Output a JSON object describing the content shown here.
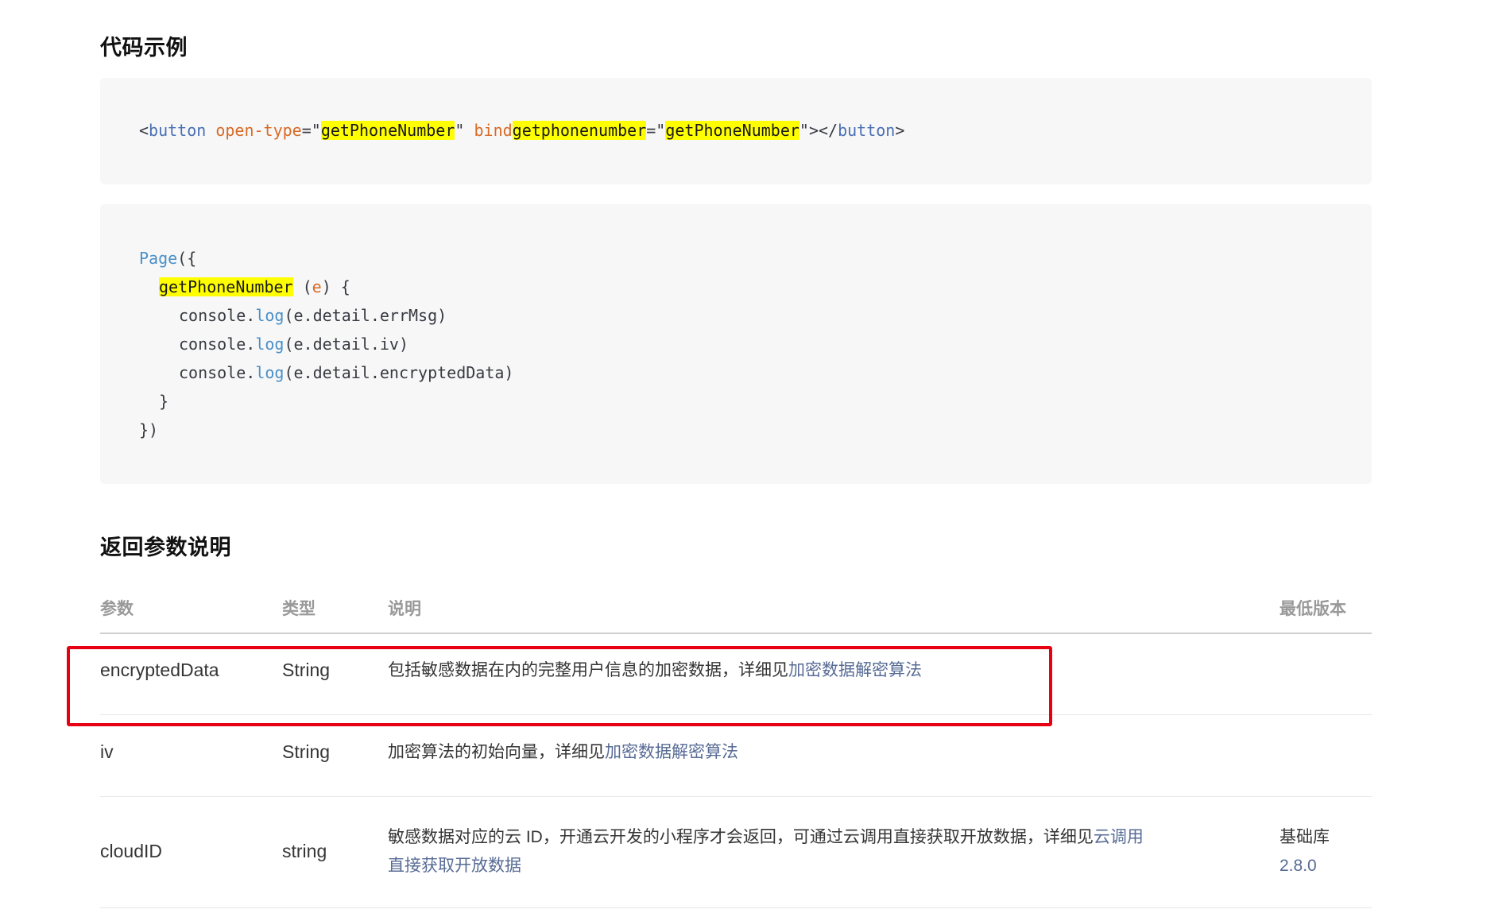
{
  "section_example": {
    "title": "代码示例"
  },
  "code1": {
    "lt": "<",
    "tag_open": "button",
    "attr1": "open-type",
    "eq_q": "=\"",
    "val1": "getPhoneNumber",
    "q_space": "\" ",
    "attr2_prefix": "bind",
    "attr2_hl": "getphonenumber",
    "eq_q2": "=\"",
    "val2": "getPhoneNumber",
    "close": "\"></",
    "tag_close": "button",
    "gt": ">"
  },
  "code2": {
    "l1_fn": "Page",
    "l1_rest": "({",
    "l2_hl": "getPhoneNumber",
    "l2_rest_a": " (",
    "l2_param": "e",
    "l2_rest_b": ") {",
    "l3_obj": "console.",
    "l3_fn": "log",
    "l3_args": "(e.detail.errMsg)",
    "l4_obj": "console.",
    "l4_fn": "log",
    "l4_args": "(e.detail.iv)",
    "l5_obj": "console.",
    "l5_fn": "log",
    "l5_args": "(e.detail.encryptedData)",
    "l6": "}",
    "l7": "})"
  },
  "section_params": {
    "title": "返回参数说明"
  },
  "table": {
    "headers": {
      "param": "参数",
      "type": "类型",
      "desc": "说明",
      "version": "最低版本"
    },
    "rows": [
      {
        "param": "encryptedData",
        "type": "String",
        "desc": "包括敏感数据在内的完整用户信息的加密数据，详细见",
        "link": "加密数据解密算法",
        "version": ""
      },
      {
        "param": "iv",
        "type": "String",
        "desc": "加密算法的初始向量，详细见",
        "link": "加密数据解密算法",
        "version": ""
      },
      {
        "param": "cloudID",
        "type": "string",
        "desc": "敏感数据对应的云 ID，开通云开发的小程序才会返回，可通过云调用直接获取开放数据，详细见",
        "link_a": "云调用",
        "link_b": "直接获取开放数据",
        "version_label": "基础库",
        "version_value": "2.8.0"
      }
    ]
  },
  "colors": {
    "highlight": "#ffff00",
    "link": "#576b95",
    "annotation": "#e60012"
  }
}
